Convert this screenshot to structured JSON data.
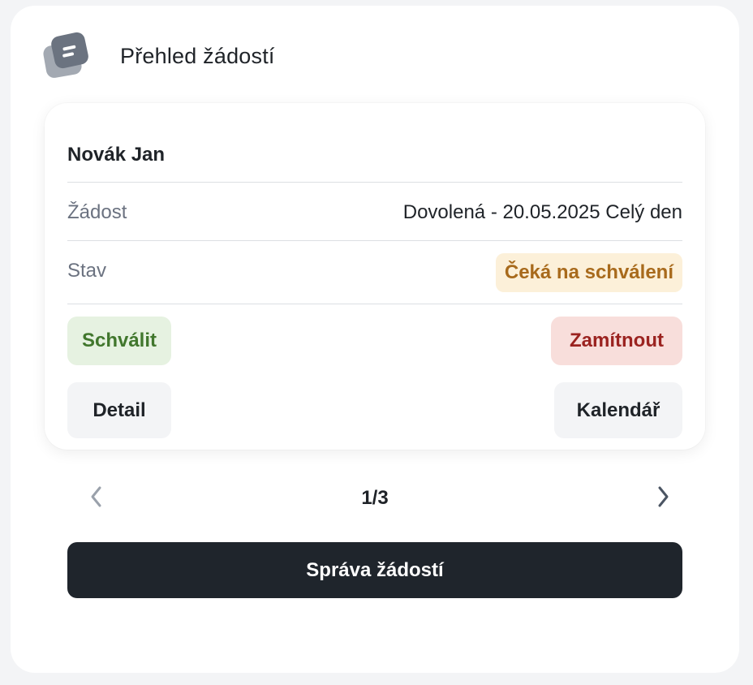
{
  "header": {
    "title": "Přehled žádostí",
    "icon": "requests-stack-icon"
  },
  "request": {
    "employee": "Novák Jan",
    "request_label": "Žádost",
    "request_value": "Dovolená - 20.05.2025 Celý den",
    "status_label": "Stav",
    "status_value": "Čeká na schválení",
    "status_color": "#a86a1c"
  },
  "actions": {
    "approve_label": "Schválit",
    "reject_label": "Zamítnout",
    "detail_label": "Detail",
    "calendar_label": "Kalendář"
  },
  "pager": {
    "counter": "1/3",
    "prev_icon": "chevron-left-icon",
    "next_icon": "chevron-right-icon"
  },
  "footer": {
    "manage_label": "Správa žádostí"
  },
  "colors": {
    "approve_bg": "#e6f2e1",
    "approve_text": "#41772d",
    "reject_bg": "#f8dedb",
    "reject_text": "#9b2320",
    "primary_dark": "#1f252c"
  }
}
